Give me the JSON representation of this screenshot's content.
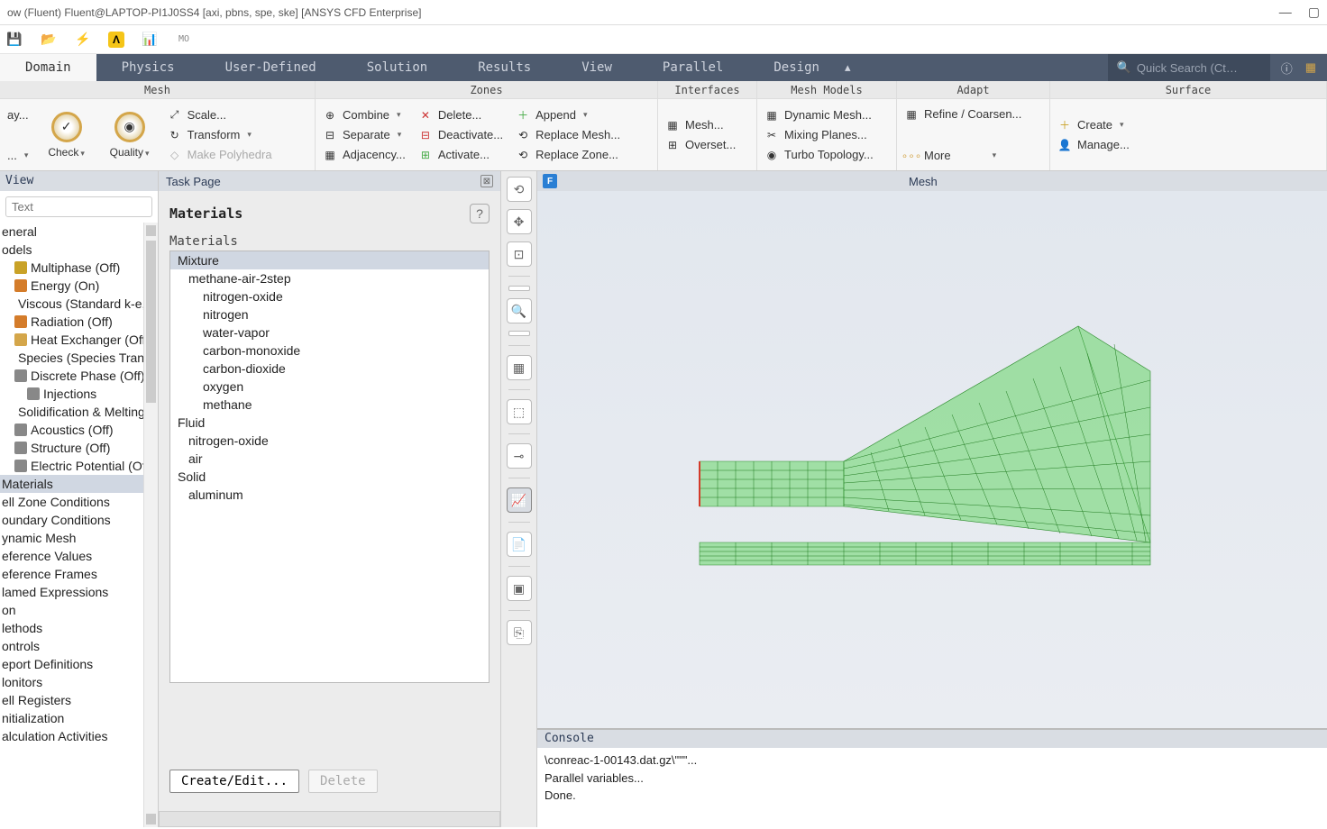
{
  "titlebar": {
    "text": "ow (Fluent) Fluent@LAPTOP-PI1J0SS4  [axi, pbns, spe, ske] [ANSYS CFD Enterprise]"
  },
  "ribbonTabs": {
    "items": [
      "Domain",
      "Physics",
      "User-Defined",
      "Solution",
      "Results",
      "View",
      "Parallel",
      "Design"
    ],
    "active": "Domain",
    "searchPlaceholder": "Quick Search (Ct…"
  },
  "ribbon": {
    "mesh": {
      "title": "Mesh",
      "display": "ay...",
      "info": "...",
      "check": "Check",
      "quality": "Quality",
      "scale": "Scale...",
      "transform": "Transform",
      "polyhedra": "Make Polyhedra"
    },
    "zones": {
      "title": "Zones",
      "combine": "Combine",
      "separate": "Separate",
      "adjacency": "Adjacency...",
      "delete": "Delete...",
      "deactivate": "Deactivate...",
      "activate": "Activate...",
      "append": "Append",
      "replaceMesh": "Replace Mesh...",
      "replaceZone": "Replace Zone..."
    },
    "interfaces": {
      "title": "Interfaces",
      "mesh": "Mesh...",
      "overset": "Overset..."
    },
    "meshModels": {
      "title": "Mesh Models",
      "dynamic": "Dynamic Mesh...",
      "mixing": "Mixing Planes...",
      "turbo": "Turbo Topology..."
    },
    "adapt": {
      "title": "Adapt",
      "refine": "Refine / Coarsen...",
      "more": "More"
    },
    "surface": {
      "title": "Surface",
      "create": "Create",
      "manage": "Manage..."
    }
  },
  "leftPanel": {
    "title": "View",
    "filterPlaceholder": "Text",
    "items": [
      {
        "label": "eneral",
        "indent": 0
      },
      {
        "label": "odels",
        "indent": 0
      },
      {
        "label": "Multiphase (Off)",
        "indent": 1,
        "icon": "#c9a227"
      },
      {
        "label": "Energy (On)",
        "indent": 1,
        "icon": "#d47c2a"
      },
      {
        "label": "Viscous (Standard k-e, St",
        "indent": 1,
        "icon": "#5aa0d8"
      },
      {
        "label": "Radiation (Off)",
        "indent": 1,
        "icon": "#d47c2a"
      },
      {
        "label": "Heat Exchanger (Off)",
        "indent": 1,
        "icon": "#d4a64a"
      },
      {
        "label": "Species (Species Transpor",
        "indent": 1,
        "icon": "#5aa0d8"
      },
      {
        "label": "Discrete Phase (Off)",
        "indent": 1,
        "icon": "#888"
      },
      {
        "label": "Injections",
        "indent": 2,
        "icon": "#888"
      },
      {
        "label": "Solidification & Melting (C",
        "indent": 1,
        "icon": "#d47c2a"
      },
      {
        "label": "Acoustics (Off)",
        "indent": 1,
        "icon": "#888"
      },
      {
        "label": "Structure (Off)",
        "indent": 1,
        "icon": "#888"
      },
      {
        "label": "Electric Potential (Off)",
        "indent": 1,
        "icon": "#888"
      },
      {
        "label": "Materials",
        "indent": 0,
        "selected": true
      },
      {
        "label": "ell Zone Conditions",
        "indent": 0
      },
      {
        "label": "oundary Conditions",
        "indent": 0
      },
      {
        "label": "ynamic Mesh",
        "indent": 0
      },
      {
        "label": "eference Values",
        "indent": 0
      },
      {
        "label": "eference Frames",
        "indent": 0
      },
      {
        "label": "lamed Expressions",
        "indent": 0
      },
      {
        "label": "on",
        "indent": 0
      },
      {
        "label": "lethods",
        "indent": 0
      },
      {
        "label": "ontrols",
        "indent": 0
      },
      {
        "label": "eport Definitions",
        "indent": 0
      },
      {
        "label": "lonitors",
        "indent": 0
      },
      {
        "label": "ell Registers",
        "indent": 0
      },
      {
        "label": "nitialization",
        "indent": 0
      },
      {
        "label": "alculation Activities",
        "indent": 0
      }
    ]
  },
  "taskPage": {
    "title": "Task Page",
    "heading": "Materials",
    "listLabel": "Materials",
    "items": [
      {
        "label": "Mixture",
        "indent": 0,
        "selected": true
      },
      {
        "label": "methane-air-2step",
        "indent": 1
      },
      {
        "label": "nitrogen-oxide",
        "indent": 2
      },
      {
        "label": "nitrogen",
        "indent": 2
      },
      {
        "label": "water-vapor",
        "indent": 2
      },
      {
        "label": "carbon-monoxide",
        "indent": 2
      },
      {
        "label": "carbon-dioxide",
        "indent": 2
      },
      {
        "label": "oxygen",
        "indent": 2
      },
      {
        "label": "methane",
        "indent": 2
      },
      {
        "label": "Fluid",
        "indent": 0
      },
      {
        "label": "nitrogen-oxide",
        "indent": 1
      },
      {
        "label": "air",
        "indent": 1
      },
      {
        "label": "Solid",
        "indent": 0
      },
      {
        "label": "aluminum",
        "indent": 1
      }
    ],
    "buttons": {
      "createEdit": "Create/Edit...",
      "delete": "Delete"
    }
  },
  "meshView": {
    "tab": "F",
    "title": "Mesh"
  },
  "console": {
    "title": "Console",
    "lines": [
      "\\conreac-1-00143.dat.gz\\\"\"\"...",
      "",
      "Parallel variables...",
      "Done."
    ]
  }
}
